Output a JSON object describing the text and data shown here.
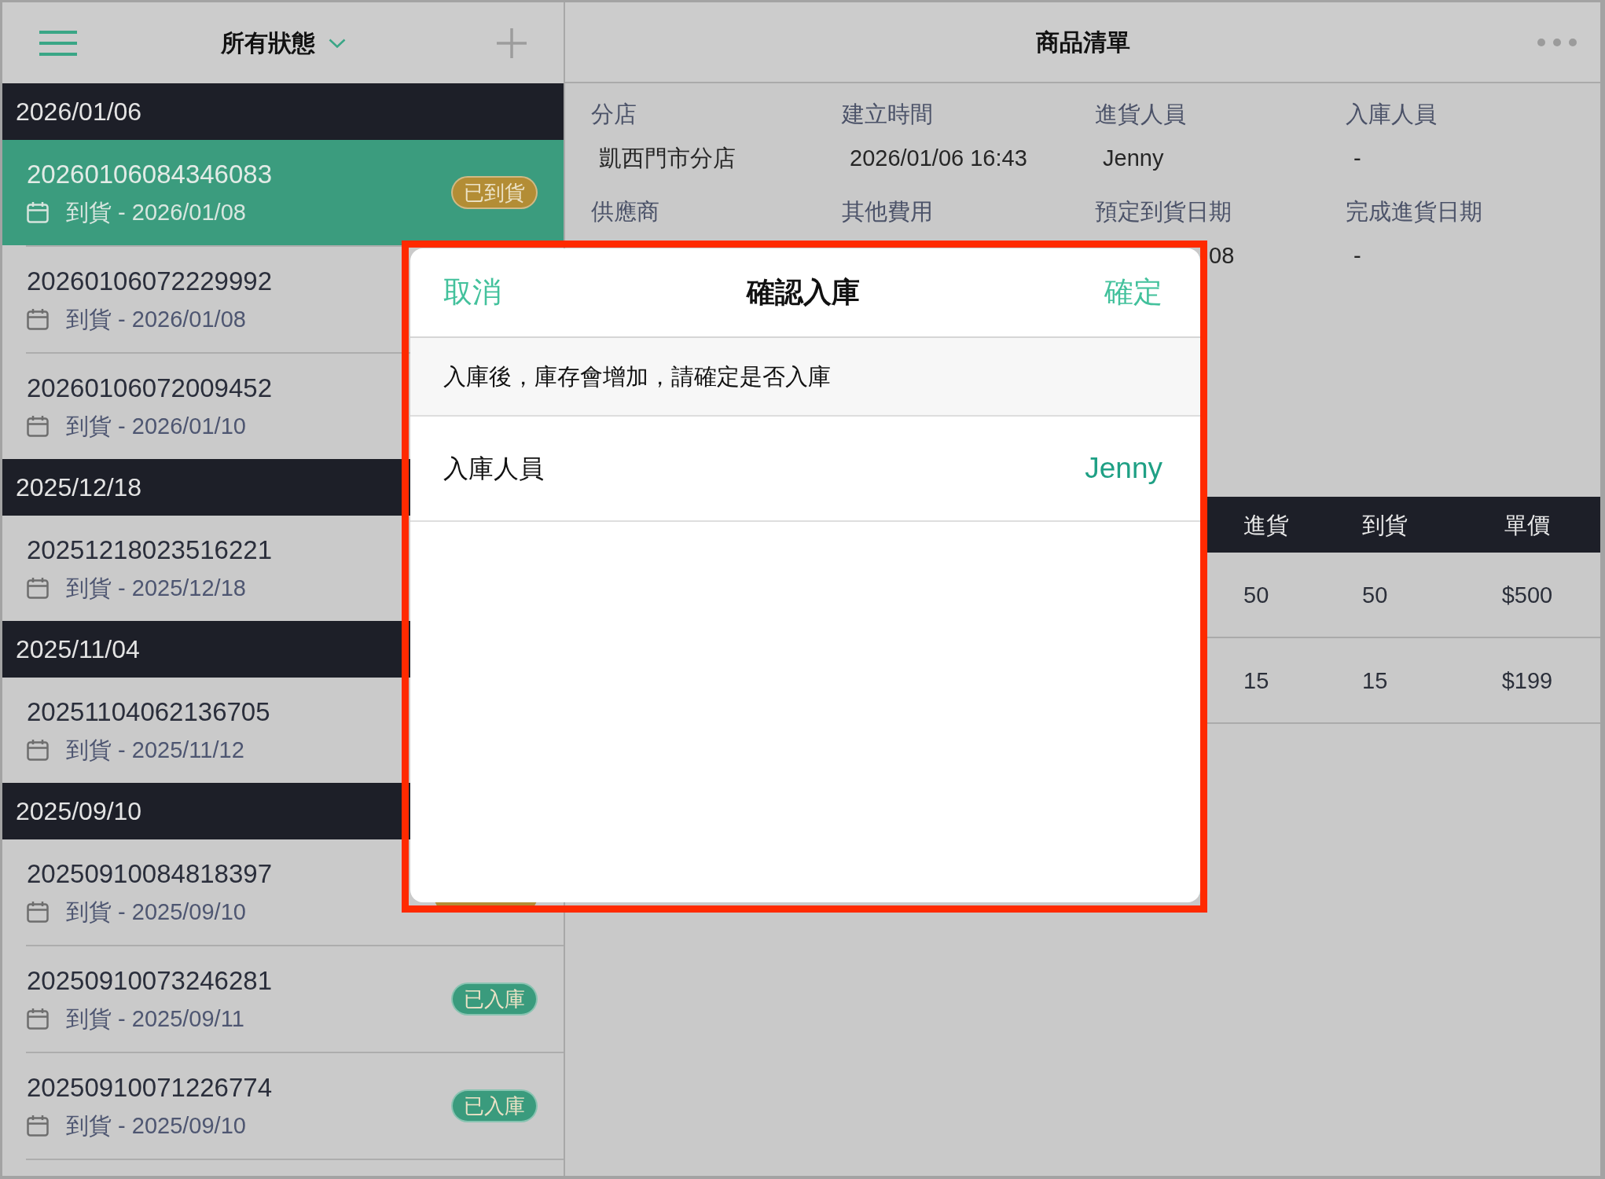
{
  "sidebar": {
    "filter": "所有狀態",
    "groups": [
      {
        "date": "2026/01/06",
        "orders": [
          {
            "number": "20260106084346083",
            "arrival": "到貨 - 2026/01/08",
            "selected": true,
            "badge": {
              "label": "已到貨",
              "color": "#b38d35"
            }
          },
          {
            "number": "20260106072229992",
            "arrival": "到貨 - 2026/01/08",
            "selected": false
          },
          {
            "number": "20260106072009452",
            "arrival": "到貨 - 2026/01/10",
            "selected": false
          }
        ]
      },
      {
        "date": "2025/12/18",
        "orders": [
          {
            "number": "20251218023516221",
            "arrival": "到貨 - 2025/12/18",
            "selected": false
          }
        ]
      },
      {
        "date": "2025/11/04",
        "orders": [
          {
            "number": "20251104062136705",
            "arrival": "到貨 - 2025/11/12",
            "selected": false
          }
        ]
      },
      {
        "date": "2025/09/10",
        "orders": [
          {
            "number": "20250910084818397",
            "arrival": "到貨 - 2025/09/10",
            "selected": false,
            "badge": {
              "color": "#b38d35"
            }
          },
          {
            "number": "20250910073246281",
            "arrival": "到貨 - 2025/09/11",
            "selected": false,
            "badge": {
              "label": "已入庫",
              "color": "#3a9b7d"
            }
          },
          {
            "number": "20250910071226774",
            "arrival": "到貨 - 2025/09/10",
            "selected": false,
            "badge": {
              "label": "已入庫",
              "color": "#3a9b7d"
            }
          }
        ]
      }
    ]
  },
  "detail": {
    "title": "商品清單",
    "fields": [
      {
        "label": "分店",
        "value": "凱西門市分店"
      },
      {
        "label": "建立時間",
        "value": "2026/01/06 16:43"
      },
      {
        "label": "進貨人員",
        "value": "Jenny"
      },
      {
        "label": "入庫人員",
        "value": "-"
      },
      {
        "label": "供應商"
      },
      {
        "label": "其他費用"
      },
      {
        "label": "預定到貨日期",
        "value": "08"
      },
      {
        "label": "完成進貨日期",
        "value": "-"
      }
    ],
    "table": {
      "columns": [
        "進貨",
        "到貨",
        "單價"
      ],
      "rows": [
        [
          "50",
          "50",
          "$500"
        ],
        [
          "15",
          "15",
          "$199"
        ]
      ]
    }
  },
  "dialog": {
    "cancel": "取消",
    "title": "確認入庫",
    "confirm": "確定",
    "message": "入庫後，庫存會增加，請確定是否入庫",
    "fields": [
      {
        "label": "入庫人員",
        "value": "Jenny"
      }
    ]
  }
}
